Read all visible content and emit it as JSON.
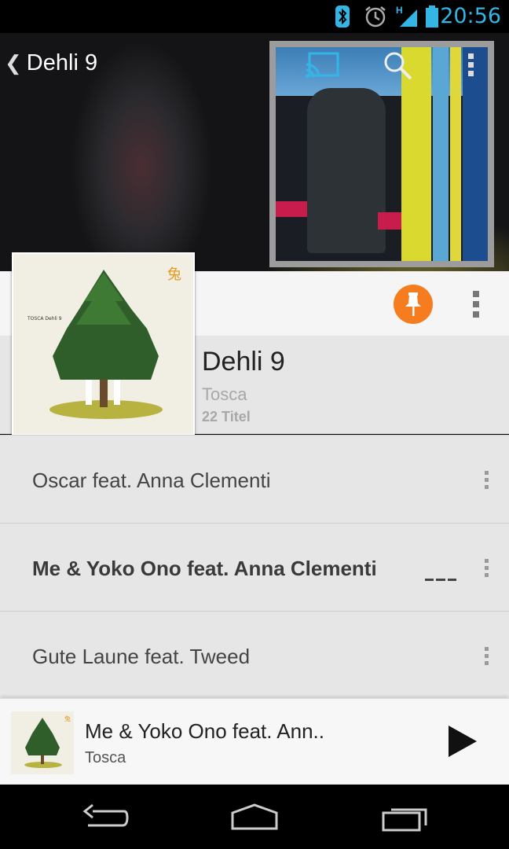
{
  "status_bar": {
    "time": "20:56",
    "icons": [
      "bluetooth-icon",
      "alarm-icon",
      "signal-icon",
      "battery-icon"
    ],
    "network_type": "H",
    "accent_color": "#33b5e5"
  },
  "header": {
    "title": "Dehli 9",
    "icons": [
      "back-chevron-icon",
      "cast-icon",
      "search-icon",
      "overflow-menu-icon"
    ]
  },
  "album": {
    "title": "Dehli 9",
    "artist": "Tosca",
    "track_count": "22 Titel",
    "pin_color": "#f57c1f"
  },
  "tracks": [
    {
      "title": "Oscar feat. Anna Clementi",
      "playing": false
    },
    {
      "title": "Me & Yoko Ono feat. Anna Clementi",
      "playing": true
    },
    {
      "title": "Gute Laune feat. Tweed",
      "playing": false
    }
  ],
  "now_playing": {
    "title": "Me & Yoko Ono feat. Ann..",
    "artist": "Tosca"
  },
  "nav_bar": {
    "icons": [
      "back-icon",
      "home-icon",
      "recents-icon"
    ]
  }
}
